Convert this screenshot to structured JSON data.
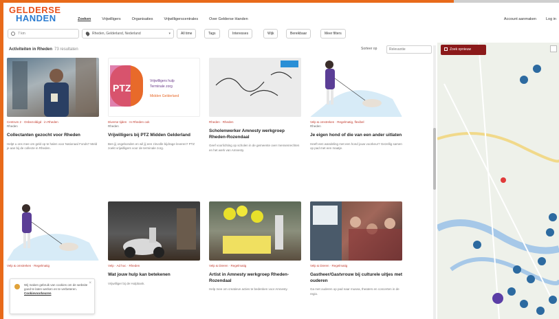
{
  "header": {
    "logo_line1": "GELDERSE",
    "logo_line2": "HANDEN",
    "nav": [
      "Zoeken",
      "Vrijwilligers",
      "Organisaties",
      "Vrijwilligerscentrales",
      "Over Gelderse Handen"
    ],
    "right": [
      "Account aanmaken",
      "Log in"
    ]
  },
  "filters": {
    "search_value": "7 km",
    "location_value": "Rheden, Gelderland, Nederland",
    "chips": [
      "All time",
      "Tags",
      "Interesses",
      "Wijk",
      "Bereikbaar",
      "Meer filters"
    ]
  },
  "results": {
    "title": "Activiteiten in Rheden",
    "count": "73 resultaten",
    "sort_label": "Sorteer op",
    "sort_value": "Relevantie"
  },
  "map": {
    "button_label": "Zoek opnieuw",
    "colors": {
      "water": "#a6c8e8",
      "road": "#f1d98a",
      "marker": "#2c6aa0",
      "cluster": "#5b3ea6"
    }
  },
  "cards": [
    {
      "meta": "Centrum 2 · Onbezoldigd · in Rheden",
      "sub": "Rheden",
      "title": "Collectanten gezocht voor Rheden",
      "desc": "Helpt u ons mee om geld op te halen voor Nationaal Fonds? Meld je aan bij de collecte in Rheden."
    },
    {
      "meta": "Diverse tijden · In Rheden ook",
      "sub": "Rheden",
      "title": "Vrijwilligers bij PTZ Midden Gelderland",
      "desc": "Ben jij ongebonden en wil jij een zinvolle bijdrage leveren? PTZ zoekt vrijwilligers voor de terminale zorg."
    },
    {
      "meta": "Rheden · Rheden",
      "sub": "",
      "title": "Scholenwerker Amnesty werkgroep Rheden-Rozendaal",
      "desc": "Geef voorlichting op scholen in de gemeente over mensenrechten en het werk van Amnesty."
    },
    {
      "meta": "Velp & omstreken · Regelmatig, flexibel",
      "sub": "Rheden",
      "title": "Je eigen hond of die van een ander uitlaten",
      "desc": "Heeft een wandeling met een hond jouw voorkeur? Gezellig samen op pad met een maatje."
    },
    {
      "meta": "Velp & omstreken · Regelmatig",
      "sub": "",
      "title": "",
      "desc": ""
    },
    {
      "meta": "Velp · Ad hoc · Rheden",
      "sub": "",
      "title": "Wat jouw hulp kan betekenen",
      "desc": "Vrijwilliger bij de Hulpbank."
    },
    {
      "meta": "Velp & Dieren · Regelmatig",
      "sub": "",
      "title": "Artist in Amnesty werkgroep Rheden-Rozendaal",
      "desc": "Help mee om creatieve acties te bedenken voor Amnesty."
    },
    {
      "meta": "Velp & Dieren · Regelmatig",
      "sub": "",
      "title": "Gastheer/Gastvrouw bij culturele uitjes met ouderen",
      "desc": "Ga met ouderen op pad naar musea, theaters en concerten in de regio."
    }
  ],
  "cookie": {
    "text": "Wij maken gebruik van cookies om de website goed te laten werken en te verbeteren.",
    "link": "Cookievoorkeuren"
  }
}
